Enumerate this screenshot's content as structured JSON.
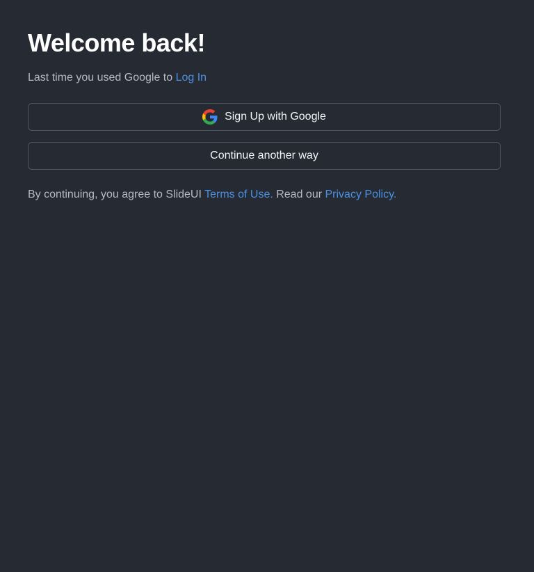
{
  "heading": "Welcome back!",
  "subtitle": {
    "prefix": "Last time you used Google to ",
    "link": "Log In"
  },
  "buttons": {
    "google": "Sign Up with Google",
    "other": "Continue another way"
  },
  "legal": {
    "prefix": "By continuing, you agree to SlideUI ",
    "terms": "Terms of Use.",
    "middle": " Read our ",
    "privacy": "Privacy Policy."
  },
  "icons": {
    "google": "google-g-icon"
  },
  "colors": {
    "background": "#262b33",
    "link": "#4a90e2",
    "muted_text": "#b4b9c2",
    "button_border": "#4e5560"
  }
}
